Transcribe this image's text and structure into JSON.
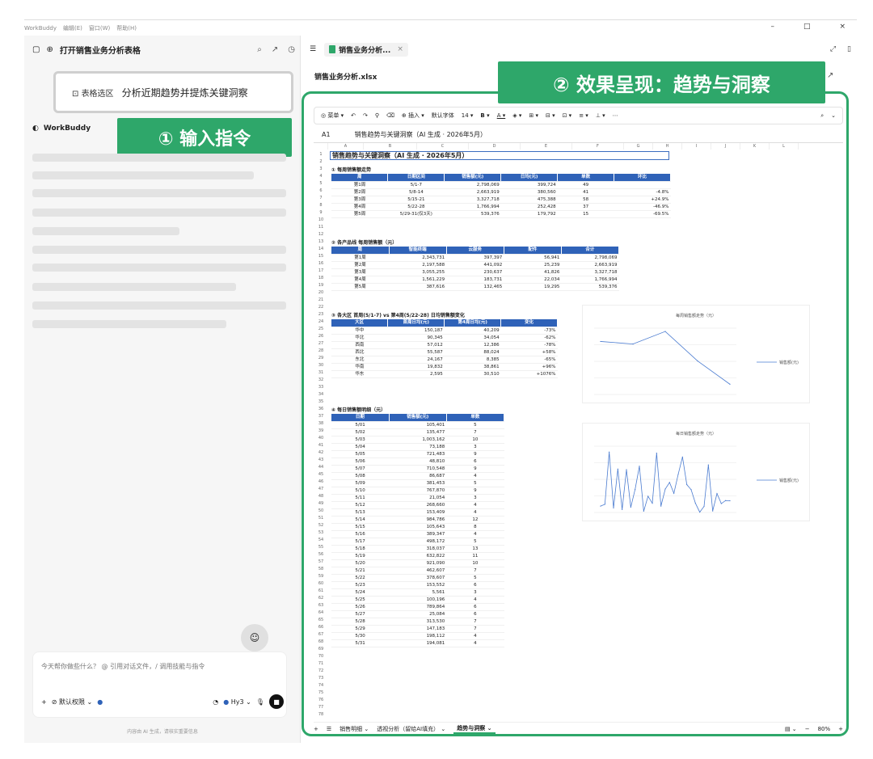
{
  "menu": {
    "app": "WorkBuddy",
    "items": [
      "编辑(E)",
      "窗口(W)",
      "帮助(H)"
    ]
  },
  "left": {
    "title": "打开销售业务分析表格",
    "chip_tag": "表格选区",
    "chip_text": "分析近期趋势并提炼关键洞察",
    "bot_name": "WorkBuddy",
    "callout1": "① 输入指令",
    "placeholder": "今天帮你做些什么？ @ 引用对话文件，/ 调用技能与指令",
    "perm": "默认权限",
    "model": "Hy3",
    "footer": "内容由 AI 生成，请核实重要信息"
  },
  "right": {
    "tab": "销售业务分析...",
    "filename": "销售业务分析.xlsx",
    "callout2": "② 效果呈现：趋势与洞察",
    "toolbar": {
      "menu": "菜单",
      "insert": "插入",
      "font": "默认字体",
      "size": "14",
      "bold": "B",
      "underline": "A"
    },
    "cellref": "A1",
    "formula": "销售趋势与关键洞察（AI 生成 · 2026年5月）",
    "columns": [
      "A",
      "B",
      "C",
      "D",
      "E",
      "F",
      "G",
      "H",
      "I",
      "J",
      "K",
      "L"
    ],
    "sheet_title": "销售趋势与关键洞察（AI 生成 · 2026年5月）",
    "s1": "① 每周销售额走势",
    "t1_head": [
      "周",
      "日期区间",
      "销售额(元)",
      "日均(元)",
      "单数",
      "环比"
    ],
    "t1_rows": [
      [
        "第1周",
        "5/1-7",
        "2,798,069",
        "399,724",
        "49",
        ""
      ],
      [
        "第2周",
        "5/8-14",
        "2,663,919",
        "380,560",
        "41",
        "-4.8%"
      ],
      [
        "第3周",
        "5/15-21",
        "3,327,718",
        "475,388",
        "58",
        "+24.9%"
      ],
      [
        "第4周",
        "5/22-28",
        "1,766,994",
        "252,428",
        "37",
        "-46.9%"
      ],
      [
        "第5周",
        "5/29-31(仅3天)",
        "539,376",
        "179,792",
        "15",
        "-69.5%"
      ]
    ],
    "s2": "② 各产品线 每周销售额（元）",
    "t2_head": [
      "周",
      "智能终端",
      "云服务",
      "配件",
      "合计"
    ],
    "t2_rows": [
      [
        "第1周",
        "2,343,731",
        "397,397",
        "56,941",
        "2,798,069"
      ],
      [
        "第2周",
        "2,197,588",
        "441,092",
        "25,239",
        "2,663,919"
      ],
      [
        "第3周",
        "3,055,255",
        "230,637",
        "41,826",
        "3,327,718"
      ],
      [
        "第4周",
        "1,561,229",
        "183,731",
        "22,034",
        "1,766,994"
      ],
      [
        "第5周",
        "387,616",
        "132,465",
        "19,295",
        "539,376"
      ]
    ],
    "s3": "③ 各大区 首周(5/1-7) vs 第4周(5/22-28) 日均销售额变化",
    "t3_head": [
      "大区",
      "首周日均(元)",
      "第4周日均(元)",
      "变化"
    ],
    "t3_rows": [
      [
        "华中",
        "150,187",
        "40,209",
        "-73%"
      ],
      [
        "华北",
        "90,345",
        "34,054",
        "-62%"
      ],
      [
        "西南",
        "57,012",
        "12,386",
        "-78%"
      ],
      [
        "西北",
        "55,587",
        "88,024",
        "+58%"
      ],
      [
        "东北",
        "24,167",
        "8,385",
        "-65%"
      ],
      [
        "华南",
        "19,832",
        "38,861",
        "+96%"
      ],
      [
        "华东",
        "2,595",
        "30,510",
        "+1076%"
      ]
    ],
    "s4": "④ 每日销售额明细（元）",
    "t4_head": [
      "日期",
      "销售额(元)",
      "单数"
    ],
    "t4_rows": [
      [
        "5/01",
        "105,401",
        "5"
      ],
      [
        "5/02",
        "135,477",
        "7"
      ],
      [
        "5/03",
        "1,003,162",
        "10"
      ],
      [
        "5/04",
        "73,188",
        "3"
      ],
      [
        "5/05",
        "721,483",
        "9"
      ],
      [
        "5/06",
        "48,810",
        "6"
      ],
      [
        "5/07",
        "710,548",
        "9"
      ],
      [
        "5/08",
        "86,687",
        "4"
      ],
      [
        "5/09",
        "381,453",
        "5"
      ],
      [
        "5/10",
        "767,870",
        "9"
      ],
      [
        "5/11",
        "21,054",
        "3"
      ],
      [
        "5/12",
        "268,660",
        "4"
      ],
      [
        "5/13",
        "153,409",
        "4"
      ],
      [
        "5/14",
        "984,786",
        "12"
      ],
      [
        "5/15",
        "105,643",
        "8"
      ],
      [
        "5/16",
        "389,347",
        "4"
      ],
      [
        "5/17",
        "498,172",
        "5"
      ],
      [
        "5/18",
        "318,037",
        "13"
      ],
      [
        "5/19",
        "632,822",
        "11"
      ],
      [
        "5/20",
        "921,090",
        "10"
      ],
      [
        "5/21",
        "462,607",
        "7"
      ],
      [
        "5/22",
        "378,607",
        "5"
      ],
      [
        "5/23",
        "153,552",
        "6"
      ],
      [
        "5/24",
        "5,561",
        "3"
      ],
      [
        "5/25",
        "100,196",
        "4"
      ],
      [
        "5/26",
        "789,864",
        "6"
      ],
      [
        "5/27",
        "25,084",
        "6"
      ],
      [
        "5/28",
        "313,530",
        "7"
      ],
      [
        "5/29",
        "147,183",
        "7"
      ],
      [
        "5/30",
        "198,112",
        "4"
      ],
      [
        "5/31",
        "194,081",
        "4"
      ]
    ],
    "sheets": [
      "销售明细",
      "透视分析（留给AI填充）",
      "趋势与洞察"
    ],
    "zoom": "80%"
  },
  "chart_data": [
    {
      "type": "line",
      "title": "每周销售额走势（元）",
      "categories": [
        "第1周",
        "第2周",
        "第3周",
        "第4周",
        "第5周"
      ],
      "series": [
        {
          "name": "销售额(元)",
          "values": [
            2798069,
            2663919,
            3327718,
            1766994,
            539376
          ]
        }
      ]
    },
    {
      "type": "line",
      "title": "每日销售额走势（元）",
      "categories": [
        "5/01",
        "5/02",
        "5/03",
        "5/04",
        "5/05",
        "5/06",
        "5/07",
        "5/08",
        "5/09",
        "5/10",
        "5/11",
        "5/12",
        "5/13",
        "5/14",
        "5/15",
        "5/16",
        "5/17",
        "5/18",
        "5/19",
        "5/20",
        "5/21",
        "5/22",
        "5/23",
        "5/24",
        "5/25",
        "5/26",
        "5/27",
        "5/28",
        "5/29",
        "5/30",
        "5/31"
      ],
      "series": [
        {
          "name": "销售额(元)",
          "values": [
            105401,
            135477,
            1003162,
            73188,
            721483,
            48810,
            710548,
            86687,
            381453,
            767870,
            21054,
            268660,
            153409,
            984786,
            105643,
            389347,
            498172,
            318037,
            632822,
            921090,
            462607,
            378607,
            153552,
            5561,
            100196,
            789864,
            25084,
            313530,
            147183,
            198112,
            194081
          ]
        }
      ]
    }
  ]
}
